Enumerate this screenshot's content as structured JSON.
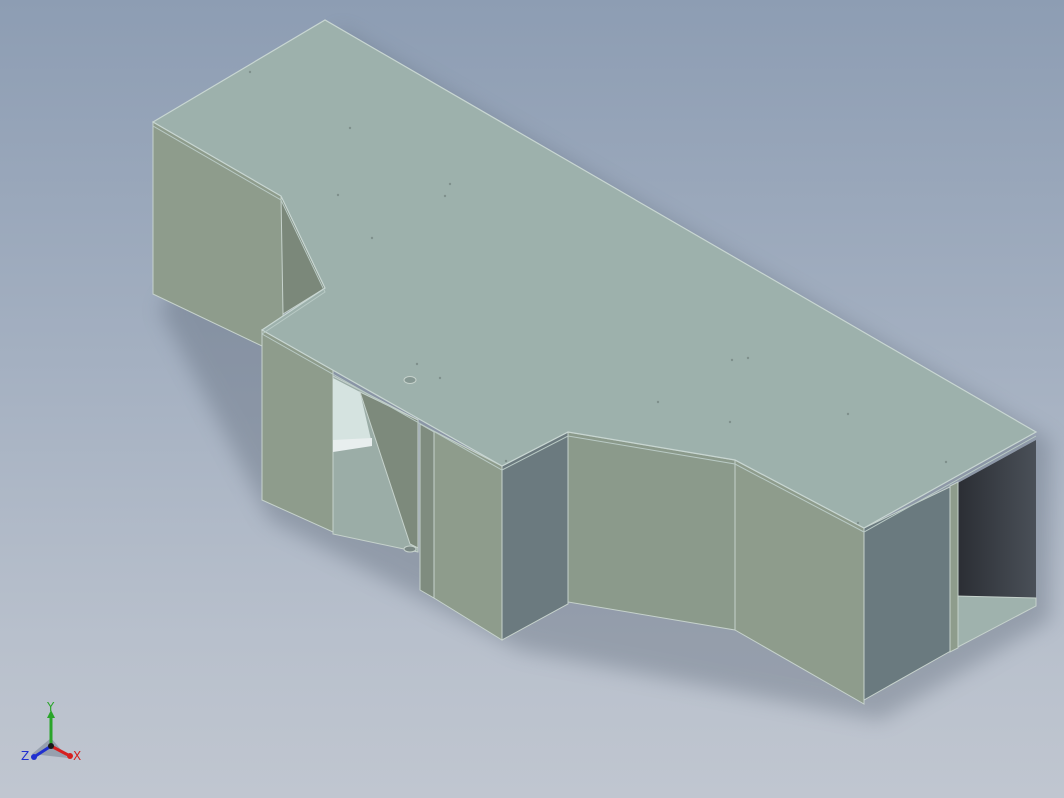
{
  "viewport": {
    "background_top": "#8d9db3",
    "background_bottom": "#c0c6d0",
    "model_name": ""
  },
  "model": {
    "top_face_color": "#9eb2ad",
    "side_face_color": "#8c9a8a",
    "dark_face_color": "#6a7a7e",
    "edge_color": "#c8d6d2"
  },
  "triad": {
    "x_label": "X",
    "y_label": "Y",
    "z_label": "Z",
    "x_color": "#d62020",
    "y_color": "#2aa52a",
    "z_color": "#2030d0"
  }
}
